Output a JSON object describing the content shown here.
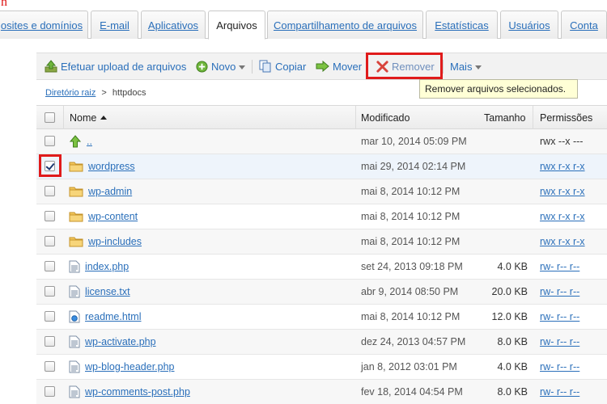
{
  "tabs": [
    {
      "label": "osites e domínios",
      "active": false
    },
    {
      "label": "E-mail",
      "active": false
    },
    {
      "label": "Aplicativos",
      "active": false
    },
    {
      "label": "Arquivos",
      "active": true
    },
    {
      "label": "Compartilhamento de arquivos",
      "active": false
    },
    {
      "label": "Estatísticas",
      "active": false
    },
    {
      "label": "Usuários",
      "active": false
    },
    {
      "label": "Conta",
      "active": false
    }
  ],
  "toolbar": {
    "upload_label": "Efetuar upload de arquivos",
    "new_label": "Novo",
    "copy_label": "Copiar",
    "move_label": "Mover",
    "remove_label": "Remover",
    "more_label": "Mais"
  },
  "tooltip": "Remover arquivos selecionados.",
  "breadcrumb": {
    "root": "Diretório raiz",
    "separator": ">",
    "current": "httpdocs"
  },
  "columns": {
    "name": "Nome",
    "modified": "Modificado",
    "size": "Tamanho",
    "permissions": "Permissões"
  },
  "rows": [
    {
      "type": "up",
      "name": "..",
      "modified": "mar 10, 2014 05:09 PM",
      "size": "",
      "permissions": "rwx --x ---",
      "checked": false
    },
    {
      "type": "folder",
      "name": "wordpress",
      "modified": "mai 29, 2014 02:14 PM",
      "size": "",
      "permissions": "rwx r-x r-x",
      "checked": true
    },
    {
      "type": "folder",
      "name": "wp-admin",
      "modified": "mai 8, 2014 10:12 PM",
      "size": "",
      "permissions": "rwx r-x r-x",
      "checked": false
    },
    {
      "type": "folder",
      "name": "wp-content",
      "modified": "mai 8, 2014 10:12 PM",
      "size": "",
      "permissions": "rwx r-x r-x",
      "checked": false
    },
    {
      "type": "folder",
      "name": "wp-includes",
      "modified": "mai 8, 2014 10:12 PM",
      "size": "",
      "permissions": "rwx r-x r-x",
      "checked": false
    },
    {
      "type": "file",
      "name": "index.php",
      "modified": "set 24, 2013 09:18 PM",
      "size": "4.0 KB",
      "permissions": "rw- r-- r--",
      "checked": false
    },
    {
      "type": "file",
      "name": "license.txt",
      "modified": "abr 9, 2014 08:50 PM",
      "size": "20.0 KB",
      "permissions": "rw- r-- r--",
      "checked": false
    },
    {
      "type": "html",
      "name": "readme.html",
      "modified": "mai 8, 2014 10:12 PM",
      "size": "12.0 KB",
      "permissions": "rw- r-- r--",
      "checked": false
    },
    {
      "type": "file",
      "name": "wp-activate.php",
      "modified": "dez 24, 2013 04:57 PM",
      "size": "8.0 KB",
      "permissions": "rw- r-- r--",
      "checked": false
    },
    {
      "type": "file",
      "name": "wp-blog-header.php",
      "modified": "jan 8, 2012 03:01 PM",
      "size": "4.0 KB",
      "permissions": "rw- r-- r--",
      "checked": false
    },
    {
      "type": "file",
      "name": "wp-comments-post.php",
      "modified": "fev 18, 2014 04:54 PM",
      "size": "8.0 KB",
      "permissions": "rw- r-- r--",
      "checked": false
    }
  ]
}
